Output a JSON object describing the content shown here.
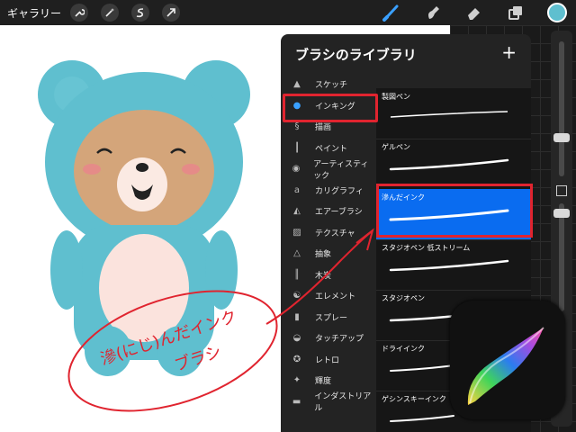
{
  "topbar": {
    "gallery_label": "ギャラリー",
    "left_tools": [
      "wrench-icon",
      "magic-wand-icon",
      "selection-s-icon",
      "arrow-move-icon"
    ],
    "right_tools": [
      "brush-icon",
      "smudge-icon",
      "eraser-icon",
      "layers-icon"
    ],
    "color": "#5fbfcf"
  },
  "panel": {
    "title": "ブラシのライブラリ",
    "add_label": "+",
    "categories": [
      {
        "label": "スケッチ",
        "icon": "pencil-tip-icon"
      },
      {
        "label": "インキング",
        "icon": "ink-drop-icon"
      },
      {
        "label": "描画",
        "icon": "squiggle-icon"
      },
      {
        "label": "ペイント",
        "icon": "paint-brush-icon"
      },
      {
        "label": "アーティスティック",
        "icon": "palette-icon"
      },
      {
        "label": "カリグラフィ",
        "icon": "calligraphy-icon"
      },
      {
        "label": "エアーブラシ",
        "icon": "airbrush-icon"
      },
      {
        "label": "テクスチャ",
        "icon": "texture-icon"
      },
      {
        "label": "抽象",
        "icon": "triangle-icon"
      },
      {
        "label": "木炭",
        "icon": "charcoal-icon"
      },
      {
        "label": "エレメント",
        "icon": "yin-yang-icon"
      },
      {
        "label": "スプレー",
        "icon": "spray-can-icon"
      },
      {
        "label": "タッチアップ",
        "icon": "touchup-icon"
      },
      {
        "label": "レトロ",
        "icon": "star-circle-icon"
      },
      {
        "label": "輝度",
        "icon": "sparkle-icon"
      },
      {
        "label": "インダストリアル",
        "icon": "anvil-icon"
      }
    ],
    "brushes": [
      {
        "label": "製図ペン"
      },
      {
        "label": "ゲルペン"
      },
      {
        "label": "滲んだインク"
      },
      {
        "label": "スタジオペン 低ストリーム"
      },
      {
        "label": "スタジオペン"
      },
      {
        "label": "ドライインク"
      },
      {
        "label": "ゲシンスキーインク"
      }
    ]
  },
  "annotation": {
    "line1": "滲(にじ)んだインク",
    "line2": "ブラシ",
    "color": "#e0242f"
  },
  "accent": "#0a6cf0"
}
